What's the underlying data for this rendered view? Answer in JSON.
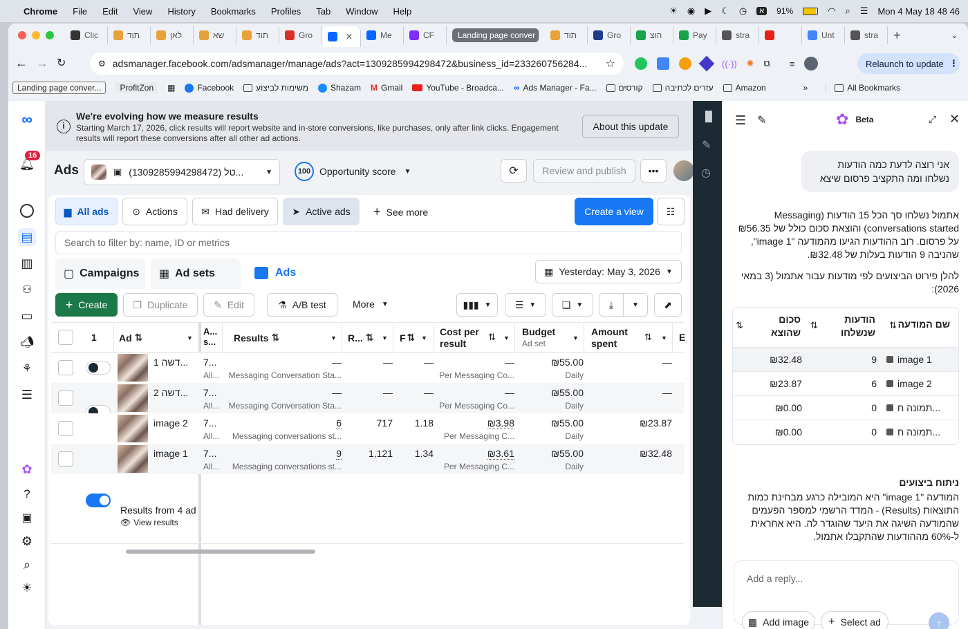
{
  "menubar": {
    "items": [
      "Chrome",
      "File",
      "Edit",
      "View",
      "History",
      "Bookmarks",
      "Profiles",
      "Tab",
      "Window",
      "Help"
    ],
    "battery": "91%",
    "keyboard": "א",
    "datetime": "Mon 4 May  18 48 46"
  },
  "tabs": [
    {
      "label": "Clic",
      "color": "#333"
    },
    {
      "label": "תוד",
      "color": "#e8a23b"
    },
    {
      "label": "לאן",
      "color": "#e8a23b"
    },
    {
      "label": "שא",
      "color": "#e8a23b"
    },
    {
      "label": "תוד",
      "color": "#e8a23b"
    },
    {
      "label": "Gro",
      "color": "#d93025"
    },
    {
      "label": "",
      "color": "#0866ff"
    },
    {
      "label": "Me",
      "color": "#0866ff"
    },
    {
      "label": "CF",
      "color": "#7b2ff7"
    },
    {
      "label": "Landing page conver",
      "color": ""
    },
    {
      "label": "תוד",
      "color": "#e8a23b"
    },
    {
      "label": "Gro",
      "color": "#1f3d8a"
    },
    {
      "label": "הוצ",
      "color": "#16a34a"
    },
    {
      "label": "Pay",
      "color": "#16a34a"
    },
    {
      "label": "stra",
      "color": "#555"
    },
    {
      "label": "",
      "color": "#e62117"
    },
    {
      "label": "Unt",
      "color": "#4285f4"
    },
    {
      "label": "stra",
      "color": "#555"
    }
  ],
  "address": {
    "url": "adsmanager.facebook.com/adsmanager/manage/ads?act=1309285994298472&business_id=233260756284...",
    "relaunch": "Relaunch to update"
  },
  "bookmarks": [
    "Landing page conver...",
    "ProfitZon",
    "Facebook",
    "משימות לביצוע",
    "Shazam",
    "Gmail",
    "YouTube - Broadca...",
    "Ads Manager - Fa...",
    "קורסים",
    "עזרים לכתיבה",
    "Amazon",
    "All Bookmarks"
  ],
  "nav": {
    "notification_count": "16"
  },
  "banner": {
    "title": "We're evolving how we measure results",
    "body": "Starting March 17, 2026, click results will report website and in-store conversions, like purchases, only after link clicks. Engagement results will report these conversions after all other ad actions.",
    "button": "About this update"
  },
  "header": {
    "title": "Ads",
    "account": "(1309285994298472) טל...",
    "opportunity_score": "100",
    "opportunity_label": "Opportunity score",
    "review": "Review and publish"
  },
  "filters": {
    "all_ads": "All ads",
    "actions": "Actions",
    "had_delivery": "Had delivery",
    "active_ads": "Active ads",
    "see_more": "See more",
    "create_view": "Create a view"
  },
  "search": {
    "placeholder": "Search to filter by: name, ID or metrics"
  },
  "levels": {
    "campaigns": "Campaigns",
    "adsets": "Ad sets",
    "ads": "Ads",
    "date": "Yesterday: May 3, 2026"
  },
  "toolbar": {
    "create": "Create",
    "duplicate": "Duplicate",
    "edit": "Edit",
    "abtest": "A/B test",
    "more": "More"
  },
  "table": {
    "headers": {
      "count": "1",
      "ad": "Ad",
      "a": "A... s...",
      "results": "Results",
      "r": "R...",
      "f": "F",
      "cost": "Cost per result",
      "budget": "Budget",
      "budget_sub": "Ad set",
      "amount": "Amount spent",
      "e": "E"
    },
    "rows": [
      {
        "name": "דשה 1...",
        "on": false,
        "id": "7...",
        "id_sub": "All...",
        "results": "—",
        "results_sub": "Messaging Conversation Sta...",
        "reach": "—",
        "freq": "—",
        "cost": "—",
        "cost_sub": "Per Messaging Co...",
        "budget": "₪55.00",
        "budget_sub": "Daily",
        "spent": "—"
      },
      {
        "name": "דשה 2...",
        "on": false,
        "id": "7...",
        "id_sub": "All...",
        "results": "—",
        "results_sub": "Messaging Conversation Sta...",
        "reach": "—",
        "freq": "—",
        "cost": "—",
        "cost_sub": "Per Messaging Co...",
        "budget": "₪55.00",
        "budget_sub": "Daily",
        "spent": "—"
      },
      {
        "name": "image 2",
        "on": true,
        "id": "7...",
        "id_sub": "All...",
        "results": "6",
        "results_sub": "Messaging conversations st...",
        "reach": "717",
        "freq": "1.18",
        "cost": "₪3.98",
        "cost_sub": "Per Messaging C...",
        "budget": "₪55.00",
        "budget_sub": "Daily",
        "spent": "₪23.87"
      },
      {
        "name": "image 1",
        "on": true,
        "id": "7...",
        "id_sub": "All...",
        "results": "9",
        "results_sub": "Messaging conversations st...",
        "reach": "1,121",
        "freq": "1.34",
        "cost": "₪3.61",
        "cost_sub": "Per Messaging C...",
        "budget": "₪55.00",
        "budget_sub": "Daily",
        "spent": "₪32.48"
      }
    ],
    "footer": "Results from 4 ad",
    "footer_link": "View results"
  },
  "assistant": {
    "beta": "Beta",
    "user_msg": "אני רוצה לדעת כמה הודעות נשלחו ומה התקציב פרסום שיצא",
    "reply1": "אתמול נשלחו סך הכל 15 הודעות (Messaging conversations started) והוצאת סכום כולל של ₪56.35 על פרסום. רוב ההודעות הגיעו מהמודעה \"image 1\", שהניבה 9 הודעות בעלות של ₪32.48.",
    "reply2": "להלן פירוט הביצועים לפי מודעות עבור אתמול (3 במאי 2026):",
    "table_headers": [
      "שם המודעה",
      "הודעות שנשלחו",
      "סכום שהוצא"
    ],
    "table_rows": [
      [
        "image 1",
        "9",
        "₪32.48"
      ],
      [
        "image 2",
        "6",
        "₪23.87"
      ],
      [
        "תמונה ח...",
        "0",
        "₪0.00"
      ],
      [
        "תמונה ח...",
        "0",
        "₪0.00"
      ]
    ],
    "analysis_title": "ניתוח ביצועים",
    "analysis": "המודעה \"image 1\" היא המובילה כרגע מבחינת כמות התוצאות (Results) - המדד הרשמי למספר הפעמים שהמודעה השיגה את היעד שהוגדר לה. היא אחראית ל-60% מההודעות שהתקבלו אתמול.",
    "reply_placeholder": "Add a reply...",
    "add_image": "Add image",
    "select_ad": "Select ad"
  },
  "colors": {
    "accent": "#1877f2",
    "create_green": "#1b7848",
    "dark_sidebar": "#1c2b33"
  }
}
